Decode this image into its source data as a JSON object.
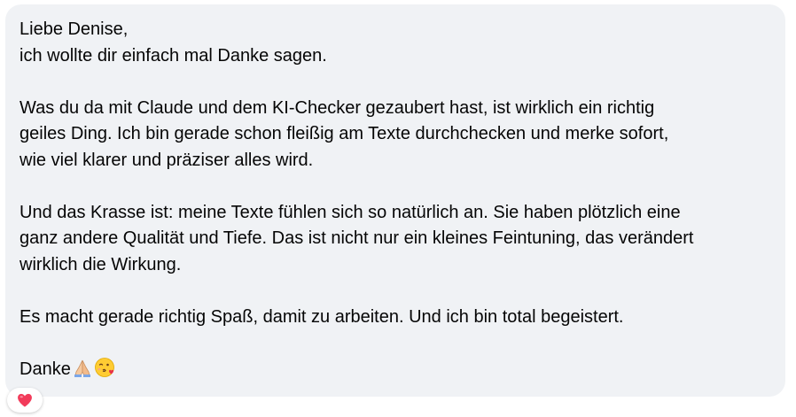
{
  "message": {
    "greeting": "Liebe Denise,",
    "line1": "ich wollte dir einfach mal Danke sagen.",
    "p1_l1": "Was du da mit Claude und dem KI-Checker gezaubert hast, ist wirklich ein richtig",
    "p1_l2": "geiles Ding. Ich bin gerade schon fleißig am Texte durchchecken und merke sofort,",
    "p1_l3": "wie viel klarer und präziser alles wird.",
    "p2_l1": "Und das Krasse ist: meine Texte fühlen sich so natürlich an. Sie haben plötzlich eine",
    "p2_l2": "ganz andere Qualität und Tiefe. Das ist nicht nur ein kleines Feintuning, das verändert",
    "p2_l3": "wirklich die Wirkung.",
    "p3_l1": "Es macht gerade richtig Spaß, damit zu arbeiten. Und ich bin total begeistert.",
    "closing": "Danke",
    "closing_emojis": [
      "folded-hands-icon",
      "face-blowing-kiss-icon"
    ]
  },
  "reaction": {
    "icon": "heart-icon",
    "color": "#f23b5a"
  },
  "colors": {
    "bubble_bg": "#f0f2f5",
    "text": "#050505"
  }
}
